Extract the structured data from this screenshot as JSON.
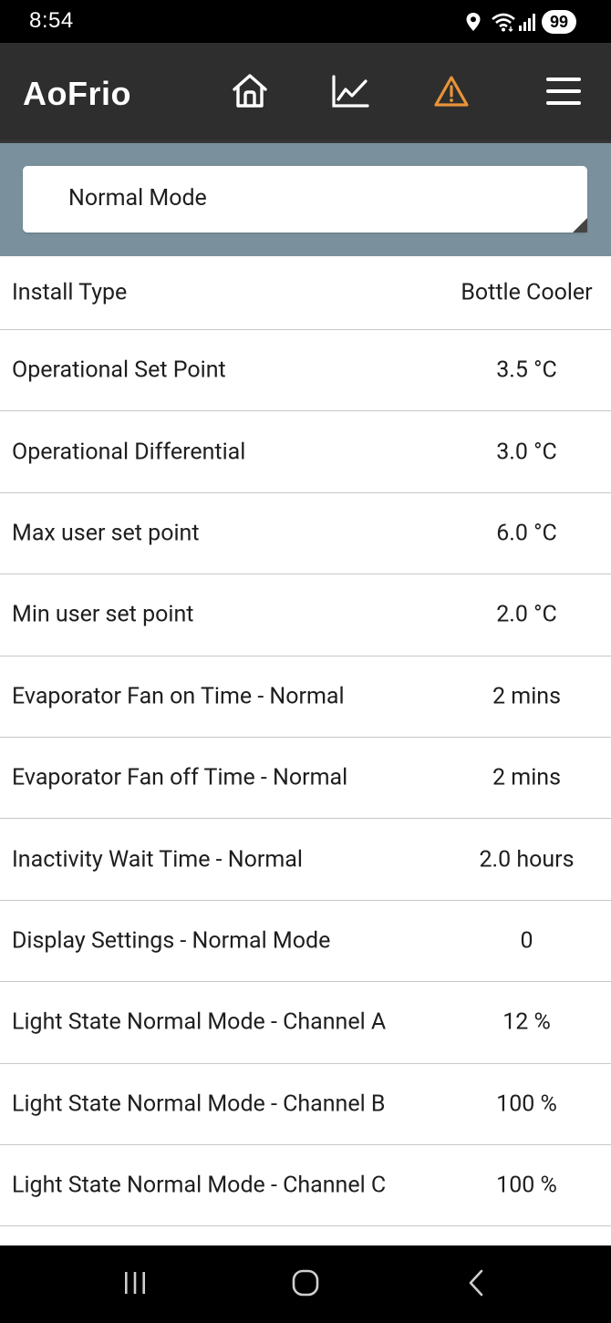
{
  "status_bar": {
    "time": "8:54",
    "battery": "99",
    "icons": [
      "location-icon",
      "wifi-icon",
      "signal-icon"
    ]
  },
  "header": {
    "logo": "AoFrio",
    "nav": [
      "home-icon",
      "chart-icon",
      "alert-icon",
      "menu-icon"
    ],
    "alert_color": "#e8933a",
    "background": "#2e2e2e"
  },
  "mode_selector": {
    "selected": "Normal Mode",
    "background": "#7a909c"
  },
  "settings": [
    {
      "label": "Install Type",
      "value": "Bottle Cooler"
    },
    {
      "label": "Operational Set Point",
      "value": "3.5 °C"
    },
    {
      "label": "Operational Differential",
      "value": "3.0 °C"
    },
    {
      "label": "Max user set point",
      "value": "6.0 °C"
    },
    {
      "label": "Min user set point",
      "value": "2.0 °C"
    },
    {
      "label": "Evaporator Fan on Time - Normal",
      "value": "2 mins"
    },
    {
      "label": "Evaporator Fan off Time - Normal",
      "value": "2 mins"
    },
    {
      "label": "Inactivity Wait Time - Normal",
      "value": "2.0 hours"
    },
    {
      "label": "Display Settings - Normal Mode",
      "value": "0"
    },
    {
      "label": "Light State Normal Mode - Channel A",
      "value": "12 %"
    },
    {
      "label": "Light State Normal Mode - Channel B",
      "value": "100 %"
    },
    {
      "label": "Light State Normal Mode - Channel C",
      "value": "100 %"
    }
  ],
  "system_nav": [
    "recent-apps-icon",
    "home-button-icon",
    "back-icon"
  ]
}
